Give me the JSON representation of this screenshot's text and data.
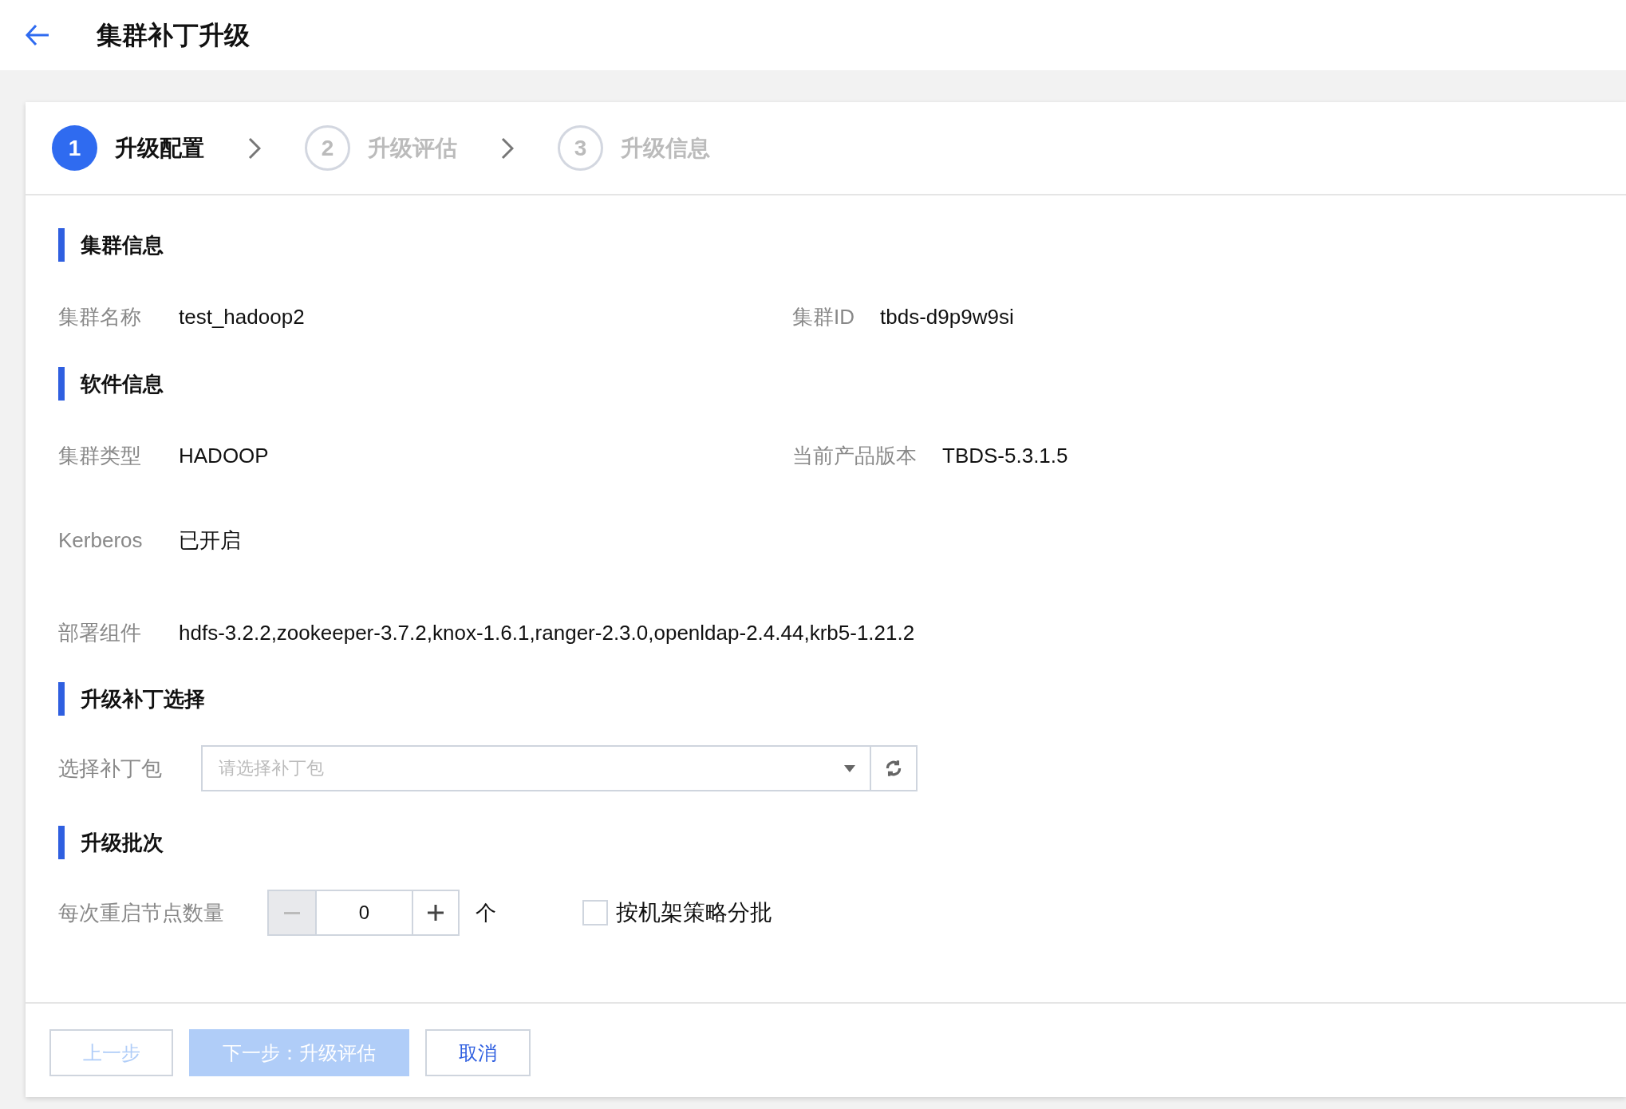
{
  "header": {
    "title": "集群补丁升级"
  },
  "steps": [
    {
      "number": "1",
      "label": "升级配置",
      "selected": true
    },
    {
      "number": "2",
      "label": "升级评估",
      "selected": false
    },
    {
      "number": "3",
      "label": "升级信息",
      "selected": false
    }
  ],
  "cluster_info": {
    "title": "集群信息",
    "fields": [
      {
        "label": "集群名称",
        "value": "test_hadoop2"
      },
      {
        "label": "集群ID",
        "value": "tbds-d9p9w9si"
      }
    ]
  },
  "software_info": {
    "title": "软件信息",
    "rows": [
      [
        {
          "label": "集群类型",
          "value": "HADOOP"
        },
        {
          "label": "当前产品版本",
          "value": "TBDS-5.3.1.5"
        }
      ],
      [
        {
          "label": "Kerberos",
          "value": "已开启"
        }
      ],
      [
        {
          "label": "部署组件",
          "value": "hdfs-3.2.2,zookeeper-3.7.2,knox-1.6.1,ranger-2.3.0,openldap-2.4.44,krb5-1.21.2"
        }
      ]
    ]
  },
  "patch_select": {
    "title": "升级补丁选择",
    "label": "选择补丁包",
    "placeholder": "请选择补丁包"
  },
  "batch": {
    "title": "升级批次",
    "label": "每次重启节点数量",
    "value": "0",
    "minus_disabled": true,
    "unit": "个",
    "rack_checkbox": {
      "label": "按机架策略分批",
      "checked": false
    }
  },
  "buttons": [
    {
      "label": "上一步",
      "kind": "outline",
      "disabled": true
    },
    {
      "label": "下一步：升级评估",
      "kind": "primary",
      "disabled": true
    },
    {
      "label": "取消",
      "kind": "outline",
      "disabled": false
    }
  ]
}
